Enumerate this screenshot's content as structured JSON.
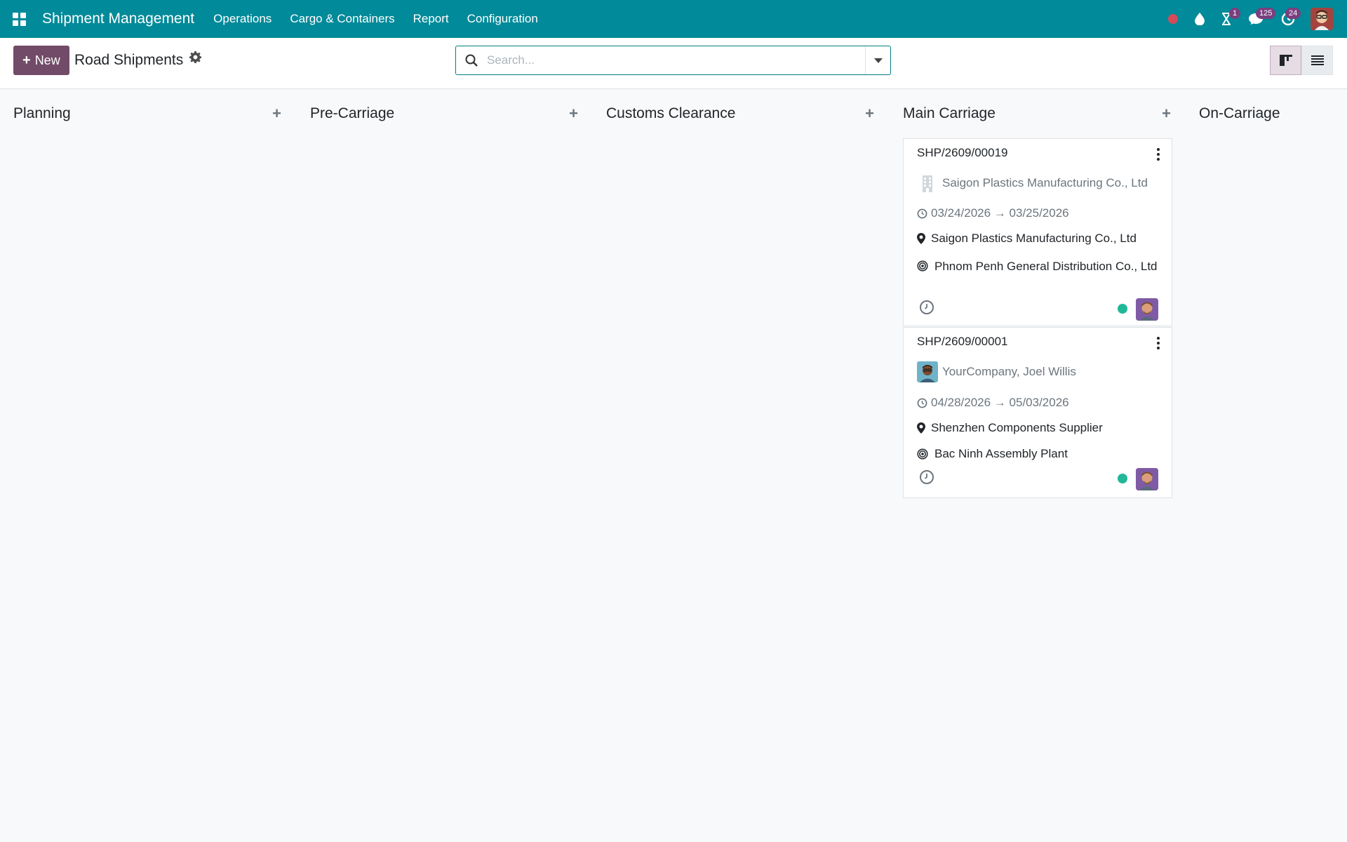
{
  "navbar": {
    "brand": "Shipment Management",
    "menus": [
      "Operations",
      "Cargo & Containers",
      "Report",
      "Configuration"
    ],
    "badges": {
      "activities": "1",
      "messages": "125",
      "updates": "24"
    },
    "colors": {
      "navbar_bg": "#018a99",
      "brand_purple": "#714b67"
    }
  },
  "control": {
    "new_label": "New",
    "title": "Road Shipments",
    "search_placeholder": "Search...",
    "views": [
      "kanban-view-icon",
      "list-view-icon"
    ],
    "active_view": "kanban"
  },
  "columns": [
    {
      "title": "Planning",
      "cards": []
    },
    {
      "title": "Pre-Carriage",
      "cards": []
    },
    {
      "title": "Customs Clearance",
      "cards": []
    },
    {
      "title": "Main Carriage",
      "cards": [
        {
          "ref": "SHP/2609/00019",
          "partner": "Saigon Plastics Manufacturing Co., Ltd",
          "dates": "03/24/2026 → 03/25/2026",
          "origin": "Saigon Plastics Manufacturing Co., Ltd",
          "destination": "Phnom Penh General Distribution Co., Ltd",
          "status_color": "#21b799"
        },
        {
          "ref": "SHP/2609/00001",
          "partner": "YourCompany, Joel Willis",
          "dates": "04/28/2026 → 05/03/2026",
          "origin": "Shenzhen Components Supplier",
          "destination": "Bac Ninh Assembly Plant",
          "status_color": "#21b799"
        }
      ]
    },
    {
      "title": "On-Carriage",
      "cards": []
    }
  ]
}
